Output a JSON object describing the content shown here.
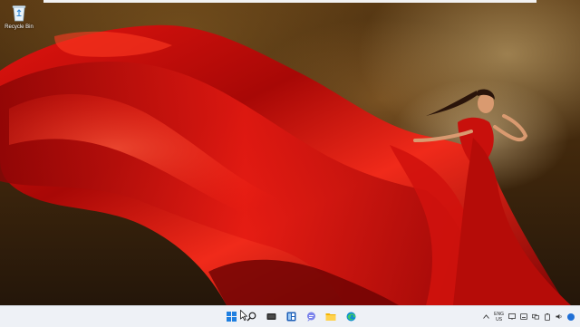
{
  "desktop": {
    "icons": [
      {
        "label": "Recycle Bin",
        "icon": "recycle-bin-icon"
      }
    ]
  },
  "taskbar": {
    "apps": [
      {
        "name": "start",
        "icon": "windows-start-icon"
      },
      {
        "name": "search",
        "icon": "search-icon"
      },
      {
        "name": "task-view",
        "icon": "task-view-icon"
      },
      {
        "name": "widgets",
        "icon": "widgets-icon"
      },
      {
        "name": "chat",
        "icon": "chat-icon"
      },
      {
        "name": "file-explorer",
        "icon": "folder-icon"
      },
      {
        "name": "edge",
        "icon": "edge-browser-icon"
      }
    ],
    "tray": {
      "language_line1": "ENG",
      "language_line2": "US"
    }
  },
  "colors": {
    "taskbar_bg": "#eef1f6",
    "accent": "#1f6fd6",
    "dress_red": "#c8100c"
  }
}
